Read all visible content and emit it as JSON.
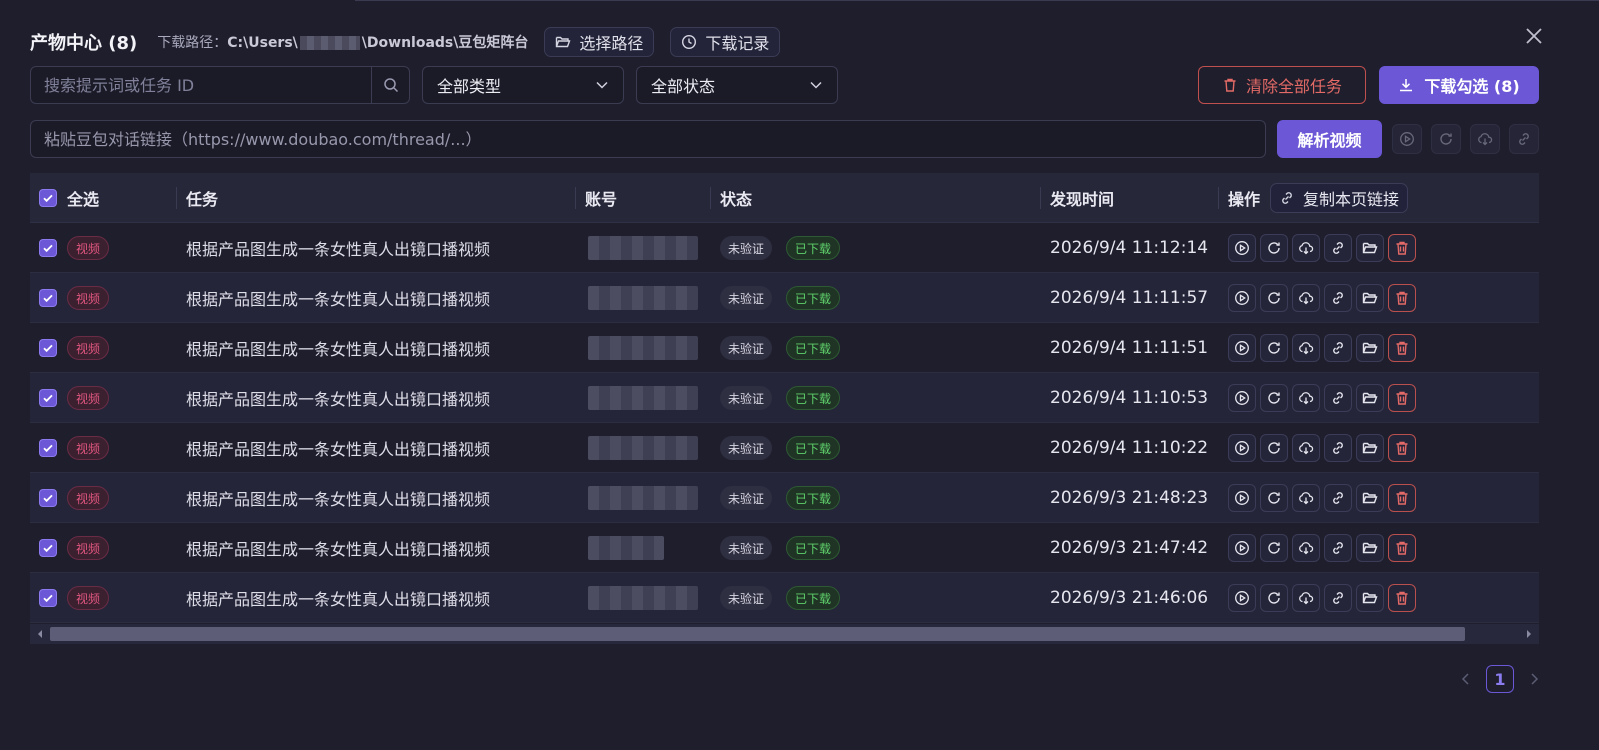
{
  "header": {
    "title": "产物中心 (8)",
    "path_label": "下载路径：",
    "path_prefix": "C:\\Users\\",
    "path_suffix": "\\Downloads\\豆包矩阵台",
    "choose_path": "选择路径",
    "download_history": "下载记录"
  },
  "filters": {
    "search_placeholder": "搜索提示词或任务 ID",
    "type_value": "全部类型",
    "status_value": "全部状态",
    "clear_all": "清除全部任务",
    "download_selected": "下载勾选 (8)"
  },
  "url_bar": {
    "placeholder": "粘贴豆包对话链接（https://www.doubao.com/thread/...）",
    "parse_label": "解析视频"
  },
  "table": {
    "headers": {
      "select_all": "全选",
      "task": "任务",
      "account": "账号",
      "status": "状态",
      "found_time": "发现时间",
      "actions": "操作",
      "copy_link": "复制本页链接"
    },
    "rows": [
      {
        "tag": "视频",
        "task": "根据产品图生成一条女性真人出镜口播视频",
        "verify": "未验证",
        "state": "已下载",
        "time": "2026/9/4 11:12:14"
      },
      {
        "tag": "视频",
        "task": "根据产品图生成一条女性真人出镜口播视频",
        "verify": "未验证",
        "state": "已下载",
        "time": "2026/9/4 11:11:57"
      },
      {
        "tag": "视频",
        "task": "根据产品图生成一条女性真人出镜口播视频",
        "verify": "未验证",
        "state": "已下载",
        "time": "2026/9/4 11:11:51"
      },
      {
        "tag": "视频",
        "task": "根据产品图生成一条女性真人出镜口播视频",
        "verify": "未验证",
        "state": "已下载",
        "time": "2026/9/4 11:10:53"
      },
      {
        "tag": "视频",
        "task": "根据产品图生成一条女性真人出镜口播视频",
        "verify": "未验证",
        "state": "已下载",
        "time": "2026/9/4 11:10:22"
      },
      {
        "tag": "视频",
        "task": "根据产品图生成一条女性真人出镜口播视频",
        "verify": "未验证",
        "state": "已下载",
        "time": "2026/9/3 21:48:23"
      },
      {
        "tag": "视频",
        "task": "根据产品图生成一条女性真人出镜口播视频",
        "verify": "未验证",
        "state": "已下载",
        "time": "2026/9/3 21:47:42"
      },
      {
        "tag": "视频",
        "task": "根据产品图生成一条女性真人出镜口播视频",
        "verify": "未验证",
        "state": "已下载",
        "time": "2026/9/3 21:46:06"
      }
    ]
  },
  "pagination": {
    "current": "1"
  },
  "colors": {
    "accent": "#6c57d6",
    "danger": "#e36a66",
    "success": "#5fd06c",
    "tag_video": "#e2567e",
    "background": "#1e1e2d"
  }
}
